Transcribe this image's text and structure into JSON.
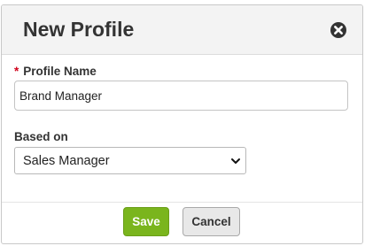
{
  "dialog": {
    "title": "New Profile",
    "close_icon": "close-circle-icon"
  },
  "form": {
    "profile_name": {
      "label": "Profile Name",
      "required_marker": "*",
      "value": "Brand Manager"
    },
    "based_on": {
      "label": "Based on",
      "selected": "Sales Manager",
      "chevron_icon": "chevron-down-icon"
    }
  },
  "actions": {
    "save_label": "Save",
    "cancel_label": "Cancel"
  },
  "colors": {
    "save_bg": "#7ab51d",
    "cancel_bg": "#e8e8e8",
    "header_bg": "#f3f3f3",
    "required": "#d0021b"
  }
}
